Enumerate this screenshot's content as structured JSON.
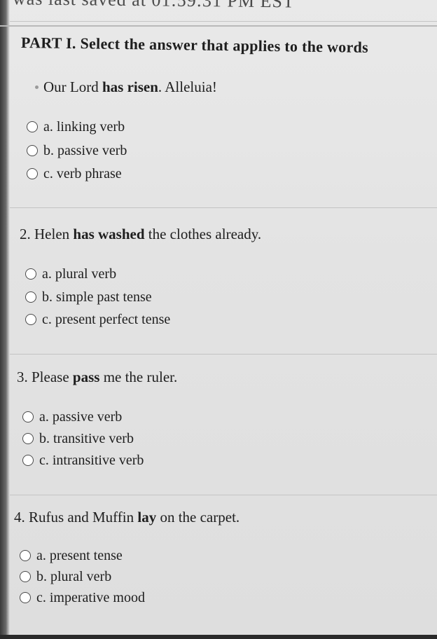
{
  "saved_notice": "was last saved at 01:59:31 PM EST",
  "part_title": "PART I. Select the answer that applies to the words",
  "questions": [
    {
      "number": "",
      "before": "Our Lord ",
      "bold": "has risen",
      "after": ". Alleluia!",
      "options": [
        "a. linking verb",
        "b. passive verb",
        "c. verb phrase"
      ]
    },
    {
      "number": "2.",
      "before": " Helen ",
      "bold": "has washed",
      "after": " the clothes already.",
      "options": [
        "a. plural verb",
        "b. simple past tense",
        "c. present perfect tense"
      ]
    },
    {
      "number": "3.",
      "before": " Please ",
      "bold": "pass",
      "after": " me the ruler.",
      "options": [
        "a. passive verb",
        "b. transitive verb",
        "c. intransitive verb"
      ]
    },
    {
      "number": "4.",
      "before": " Rufus and Muffin ",
      "bold": "lay",
      "after": " on the carpet.",
      "options": [
        "a. present tense",
        "b. plural verb",
        "c. imperative mood"
      ]
    }
  ]
}
